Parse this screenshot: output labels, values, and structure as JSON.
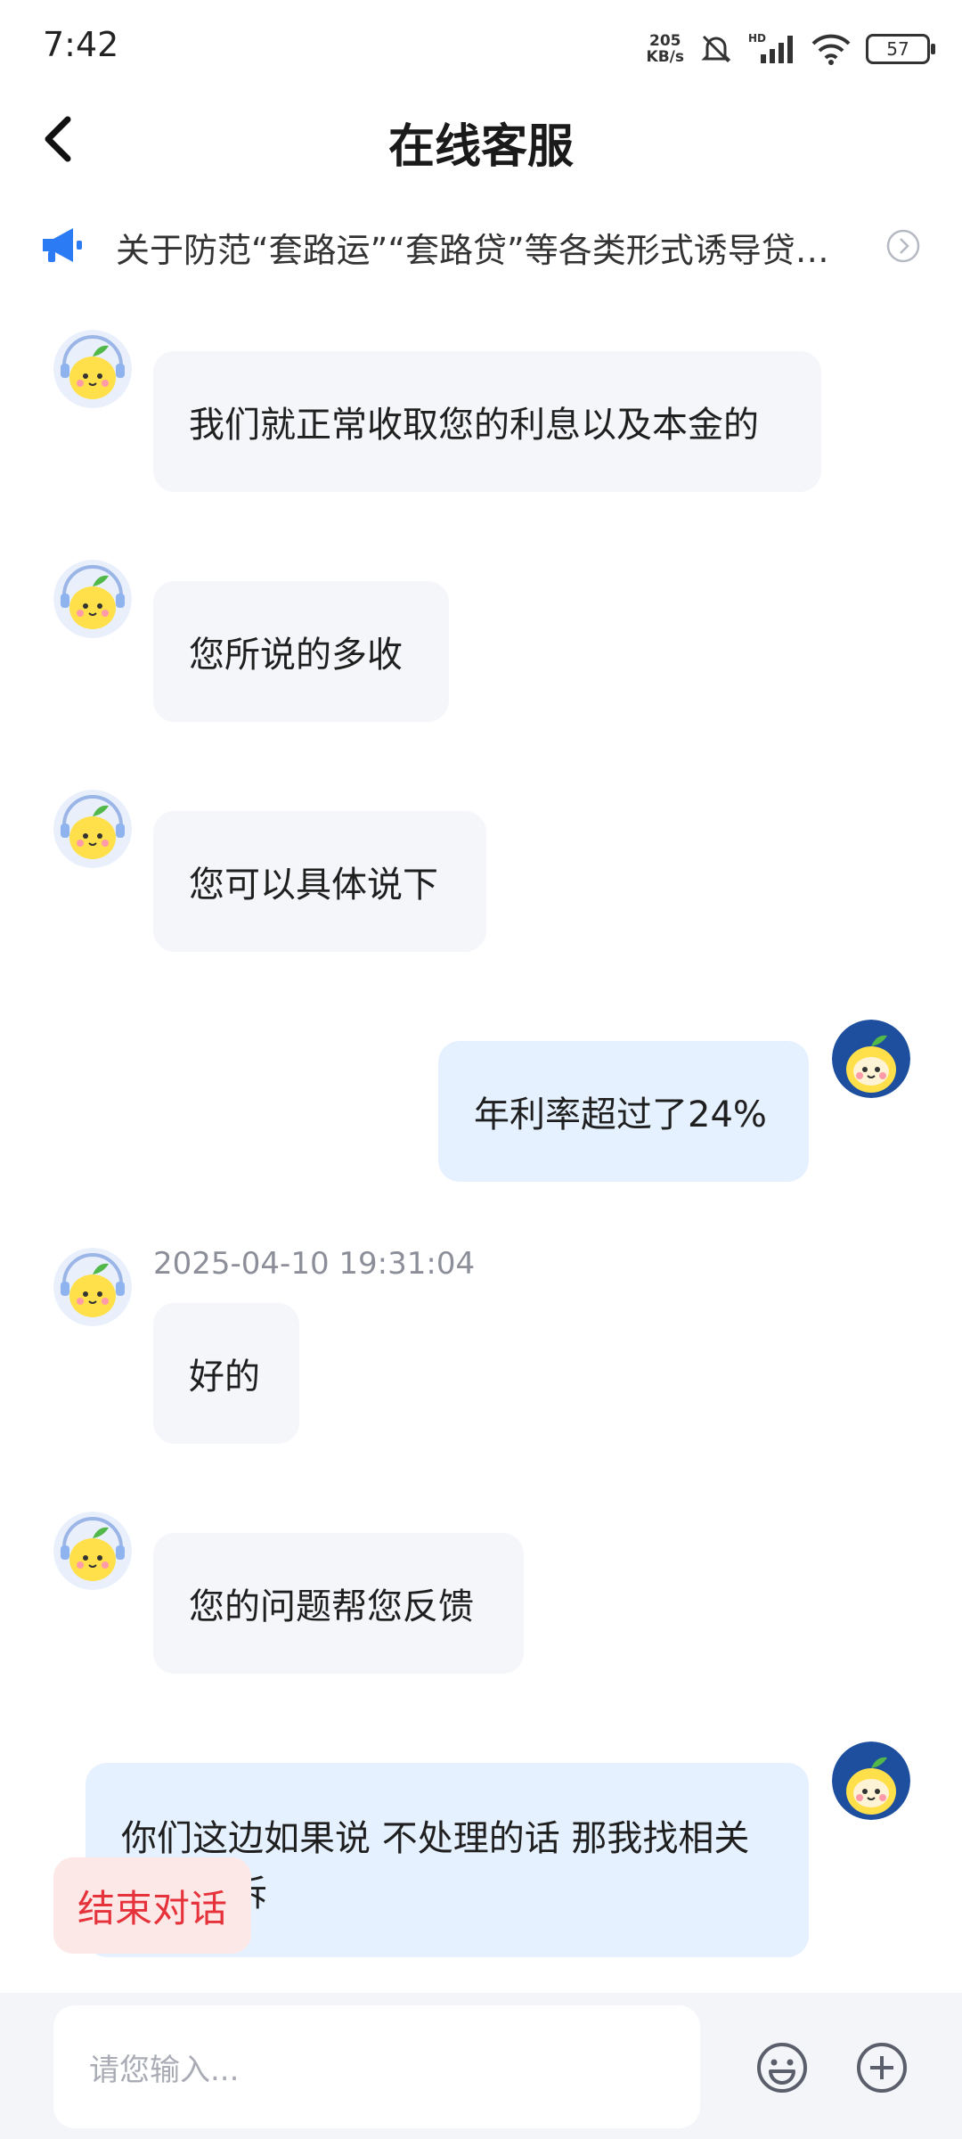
{
  "status_bar": {
    "time": "7:42",
    "net_speed_value": "205",
    "net_speed_unit": "KB/s",
    "hd_label": "HD",
    "battery": "57"
  },
  "header": {
    "title": "在线客服"
  },
  "notice": {
    "text": "关于防范“套路运”“套路贷”等各类形式诱导贷款的提示"
  },
  "messages": [
    {
      "sender": "agent",
      "text": "我们就正常收取您的利息以及本金的"
    },
    {
      "sender": "agent",
      "text": "您所说的多收"
    },
    {
      "sender": "agent",
      "text": "您可以具体说下"
    },
    {
      "sender": "user",
      "text": "年利率超过了24%"
    },
    {
      "sender": "agent",
      "timestamp": "2025-04-10 19:31:04",
      "text": "好的"
    },
    {
      "sender": "agent",
      "text": "您的问题帮您反馈"
    },
    {
      "sender": "user",
      "text": "你们这边如果说 不处理的话 那我找相关",
      "text_line2": "诉"
    }
  ],
  "end_button": "结束对话",
  "input": {
    "placeholder": "请您输入..."
  },
  "icons": {
    "back": "back-arrow-icon",
    "notice": "megaphone-icon",
    "emoji": "emoji-icon",
    "plus": "plus-icon"
  },
  "colors": {
    "accent": "#2b7bf5",
    "agent_bubble": "#f5f6fa",
    "user_bubble": "#e6f1ff",
    "end_button_text": "#e5323b"
  }
}
